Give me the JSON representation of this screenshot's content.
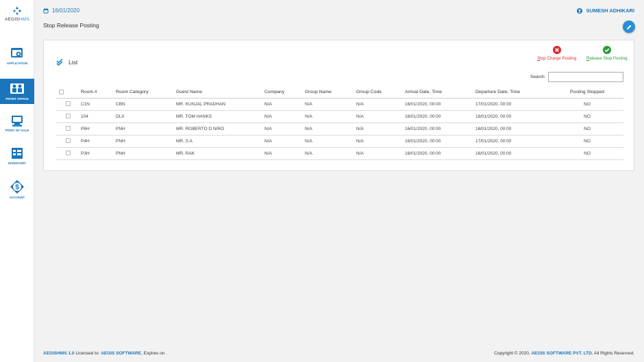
{
  "brand": {
    "prefix": "AEGIS",
    "suffix": "HMS"
  },
  "nav": [
    {
      "label": "APPLICATION"
    },
    {
      "label": "FRONT OFFICE"
    },
    {
      "label": "POINT OF SALE"
    },
    {
      "label": "INVENTORY"
    },
    {
      "label": "ACCOUNT"
    }
  ],
  "header": {
    "date": "16/01/2020",
    "user": "SUMESH ADHIKARI"
  },
  "page": {
    "title": "Stop Release Posting"
  },
  "list": {
    "title": "List",
    "search_label": "Search:",
    "search_value": "",
    "actions": {
      "stop_first": "S",
      "stop_rest": "top Charge Posting",
      "release_first": "R",
      "release_rest": "elease Stop Posting"
    },
    "columns": [
      "Room #",
      "Room Category",
      "Guest Name",
      "Company",
      "Group Name",
      "Group Code",
      "Arrival Date, Time",
      "Departure Date, Time",
      "Posting Stopped"
    ],
    "rows": [
      [
        "C1N",
        "CBN",
        "MR. KUNJAL PRADHAN",
        "N/A",
        "N/A",
        "N/A",
        "16/01/2020, 00:00",
        "17/01/2020, 00:00",
        "NO"
      ],
      [
        "104",
        "DLX",
        "MR. TOM HANKS",
        "N/A",
        "N/A",
        "N/A",
        "16/01/2020, 00:00",
        "18/01/2020, 00:00",
        "NO"
      ],
      [
        "P6H",
        "PNH",
        "MR. ROBERTO D NIRO",
        "N/A",
        "N/A",
        "N/A",
        "16/01/2020, 00:00",
        "18/01/2020, 00:00",
        "NO"
      ],
      [
        "P4H",
        "PNH",
        "MR. S A",
        "N/A",
        "N/A",
        "N/A",
        "16/01/2020, 00:00",
        "17/01/2020, 00:00",
        "NO"
      ],
      [
        "P3H",
        "PNH",
        "MR. RAK",
        "N/A",
        "N/A",
        "N/A",
        "16/01/2020, 00:00",
        "16/01/2020, 00:00",
        "NO"
      ]
    ]
  },
  "footer": {
    "product": "AEGISHMS 1.0",
    "licensed_to_label": " Licensed to: ",
    "licensee": "AEGIS SOFTWARE",
    "expires": ", Expires on .",
    "copyright_prefix": "Copyright © 2020, ",
    "company": "AEGIS SOFTWARE PVT. LTD.",
    "rights": " All Rights Reserved."
  },
  "colors": {
    "primary": "#1a75bb",
    "accent": "#2a8fd6",
    "danger": "#e02b2b",
    "success": "#2d9a37"
  }
}
